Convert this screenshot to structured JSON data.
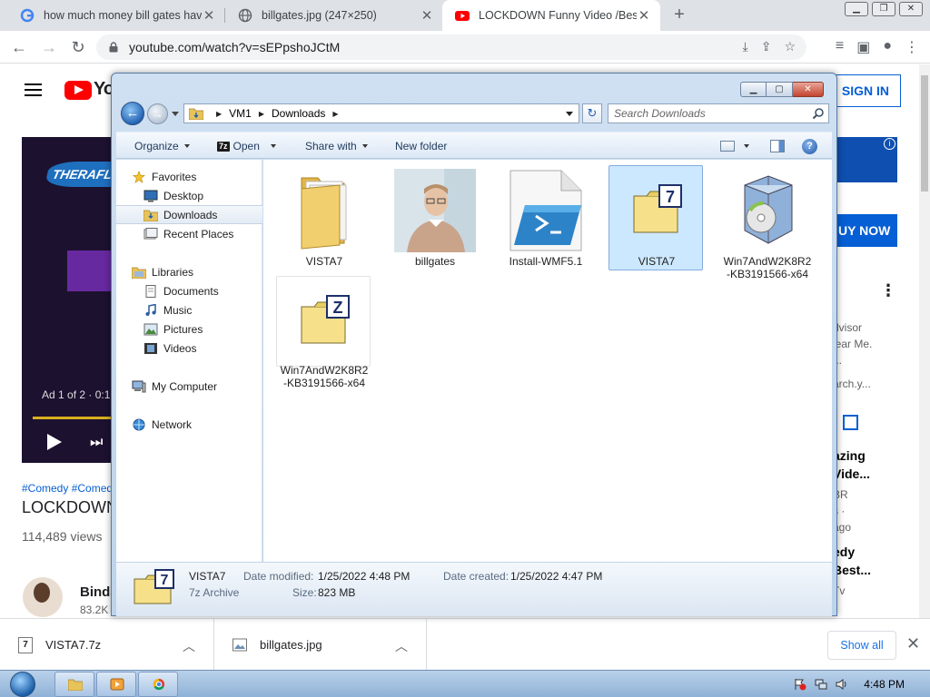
{
  "browser": {
    "tabs": [
      {
        "title": "how much money bill gates have",
        "close": "✕"
      },
      {
        "title": "billgates.jpg (247×250)",
        "close": "✕"
      },
      {
        "title": "LOCKDOWN Funny Video /Best /",
        "close": "✕"
      }
    ],
    "new_tab": "+",
    "url": "youtube.com/watch?v=sEPpshoJCtM"
  },
  "youtube": {
    "logo_text": "Yo",
    "sign_in": "SIGN IN",
    "ad_brand": "THERAFLU",
    "ad_counter": "Ad 1 of 2 · 0:1",
    "hashtags": "#Comedy #Comed",
    "video_title": "LOCKDOWN",
    "views": "114,489 views",
    "channel_name": "Binda",
    "subscribers": "83.2K",
    "buy_now": "UY NOW",
    "info": "i",
    "sidebar_text": {
      "advisor": "dvisor",
      "clear": "lear Me.",
      "dots": "...",
      "search": "arch.y...",
      "title_line1": "azing",
      "title_line2": "Vide...",
      "ch": "BR",
      "meta1": "s ·",
      "meta2": "ago",
      "title2_line1": "edy",
      "title2_line2": "Best...",
      "ch2": "Tv"
    }
  },
  "downloads": {
    "items": [
      {
        "name": "VISTA7.7z",
        "icon": "7z-icon"
      },
      {
        "name": "billgates.jpg",
        "icon": "image-icon"
      }
    ],
    "show_all": "Show all"
  },
  "taskbar": {
    "clock": "4:48 PM"
  },
  "explorer": {
    "breadcrumb": [
      "VM1",
      "Downloads"
    ],
    "search_placeholder": "Search Downloads",
    "commands": {
      "organize": "Organize",
      "open": "Open",
      "share_with": "Share with",
      "new_folder": "New folder"
    },
    "nav": {
      "favorites": "Favorites",
      "desktop": "Desktop",
      "downloads": "Downloads",
      "recent_places": "Recent Places",
      "libraries": "Libraries",
      "documents": "Documents",
      "music": "Music",
      "pictures": "Pictures",
      "videos": "Videos",
      "my_computer": "My Computer",
      "network": "Network"
    },
    "files": [
      {
        "name": "VISTA7",
        "type": "folder"
      },
      {
        "name": "billgates",
        "type": "image"
      },
      {
        "name": "Install-WMF5.1",
        "type": "powershell"
      },
      {
        "name": "VISTA7",
        "type": "7z-archive",
        "selected": true
      },
      {
        "name": "Win7AndW2K8R2\n-KB3191566-x64",
        "type": "installer"
      },
      {
        "name": "Win7AndW2K8R2\n-KB3191566-x64",
        "type": "zip-archive"
      }
    ],
    "details": {
      "name": "VISTA7",
      "type": "7z Archive",
      "date_modified_label": "Date modified:",
      "date_modified": "1/25/2022 4:48 PM",
      "size_label": "Size:",
      "size": "823 MB",
      "date_created_label": "Date created:",
      "date_created": "1/25/2022 4:47 PM"
    }
  },
  "colors": {
    "selection": "#cce8ff",
    "youtube_red": "#ff0000",
    "link_blue": "#065fd4"
  }
}
